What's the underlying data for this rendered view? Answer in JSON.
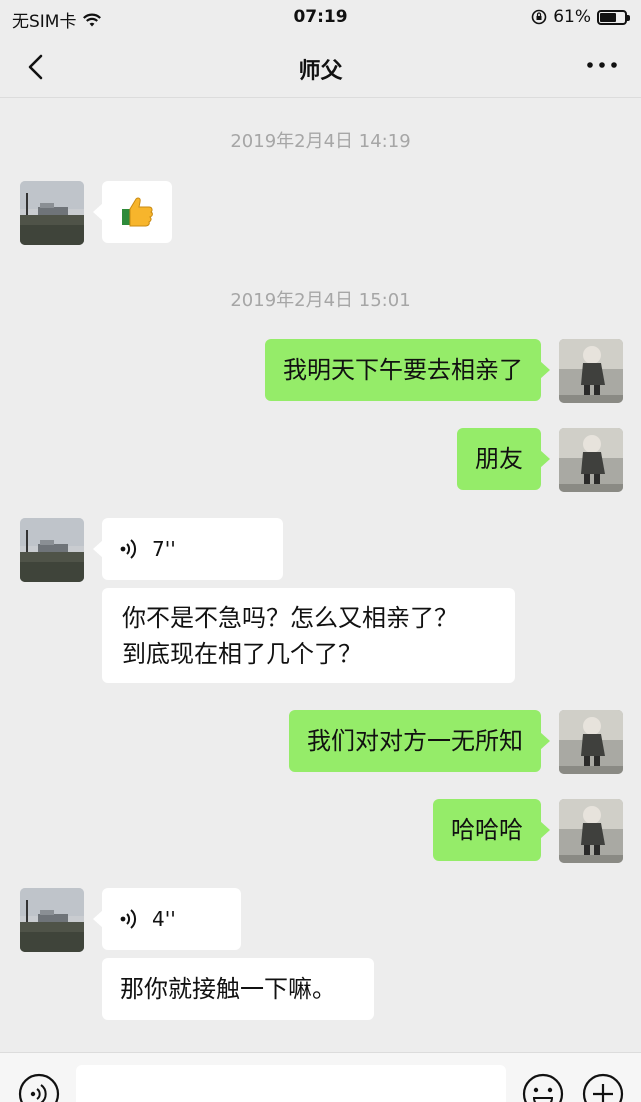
{
  "status_bar": {
    "carrier": "无SIM卡",
    "time": "07:19",
    "battery": "61%"
  },
  "nav": {
    "title": "师父"
  },
  "messages": {
    "ts1": "2019年2月4日 14:19",
    "ts2": "2019年2月4日 15:01",
    "m2": "我明天下午要去相亲了",
    "m3": "朋友",
    "voice1": "7''",
    "m5_line1": "你不是不急吗？怎么又相亲了？",
    "m5_line2": "到底现在相了几个了？",
    "m6": "我们对对方一无所知",
    "m7": "哈哈哈",
    "voice2": "4''",
    "m9": "那你就接触一下嘛。"
  },
  "colors": {
    "background": "#ededed",
    "outgoing_bubble": "#95ec69",
    "incoming_bubble": "#ffffff",
    "timestamp": "#a6a6a6"
  },
  "icons": [
    "back-icon",
    "more-icon",
    "thumbs-up-icon",
    "voice-icon",
    "voice-input-icon",
    "emoji-icon",
    "plus-icon",
    "wifi-icon",
    "lock-rotation-icon",
    "battery-icon"
  ]
}
